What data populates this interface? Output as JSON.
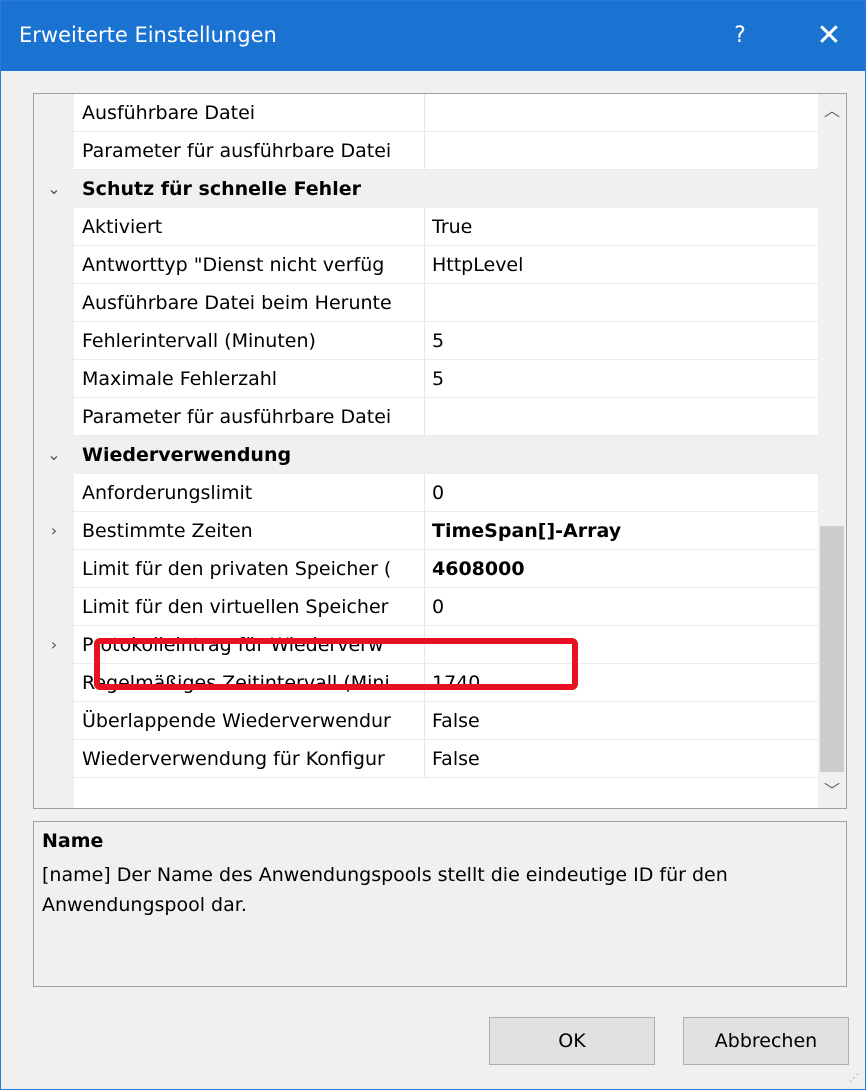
{
  "window": {
    "title": "Erweiterte Einstellungen",
    "help_label": "?",
    "close_label": "✕"
  },
  "grid": {
    "rows": [
      {
        "name": "Ausführbare Datei",
        "value": ""
      },
      {
        "name": "Parameter für ausführbare Datei",
        "value": ""
      },
      {
        "category": true,
        "expander": "expanded",
        "name": "Schutz für schnelle Fehler"
      },
      {
        "name": "Aktiviert",
        "value": "True"
      },
      {
        "name": "Antworttyp \"Dienst nicht verfüg",
        "value": "HttpLevel"
      },
      {
        "name": "Ausführbare Datei beim Herunte",
        "value": ""
      },
      {
        "name": "Fehlerintervall (Minuten)",
        "value": "5"
      },
      {
        "name": "Maximale Fehlerzahl",
        "value": "5"
      },
      {
        "name": "Parameter für ausführbare Datei",
        "value": ""
      },
      {
        "category": true,
        "expander": "expanded",
        "name": "Wiederverwendung"
      },
      {
        "name": "Anforderungslimit",
        "value": "0"
      },
      {
        "expander": "collapsed",
        "name": "Bestimmte Zeiten",
        "value": "TimeSpan[]-Array",
        "bold": true
      },
      {
        "name": "Limit für den privaten Speicher (",
        "value": "4608000",
        "bold": true,
        "highlighted": true
      },
      {
        "name": "Limit für den virtuellen Speicher",
        "value": "0"
      },
      {
        "expander": "collapsed",
        "name": "Protokolleintrag für Wiederverw",
        "value": ""
      },
      {
        "name": "Regelmäßiges Zeitintervall (Mini",
        "value": "1740"
      },
      {
        "name": "Überlappende Wiederverwendur",
        "value": "False"
      },
      {
        "name": "Wiederverwendung für Konfigur",
        "value": "False"
      }
    ],
    "scroll_up_icon": "chevron-up-icon",
    "scroll_down_icon": "chevron-down-icon"
  },
  "description": {
    "heading": "Name",
    "text": "[name] Der Name des Anwendungspools stellt die eindeutige ID für den Anwendungspool dar."
  },
  "buttons": {
    "ok_label": "OK",
    "cancel_label": "Abbrechen"
  },
  "colors": {
    "titlebar": "#1a73d1",
    "highlight": "#e81123"
  }
}
